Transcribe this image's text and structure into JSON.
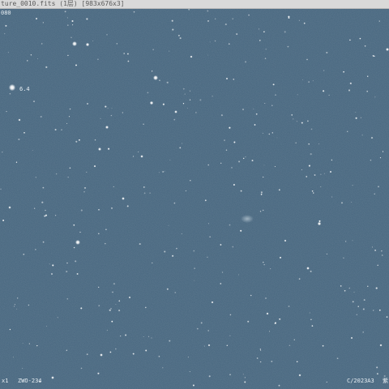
{
  "window": {
    "title": "ture_0010.fits (1层) [983x676x3]"
  },
  "overlay": {
    "top_left": "080",
    "star_label": "6.4",
    "bottom_zoom": "x1",
    "bottom_camera": "ZWO-234",
    "bottom_object": "C/2023A3",
    "bottom_right": "紫"
  },
  "colors": {
    "sky": "#41617a",
    "star": "#ffffff",
    "titlebar": "#d9d9d9"
  }
}
